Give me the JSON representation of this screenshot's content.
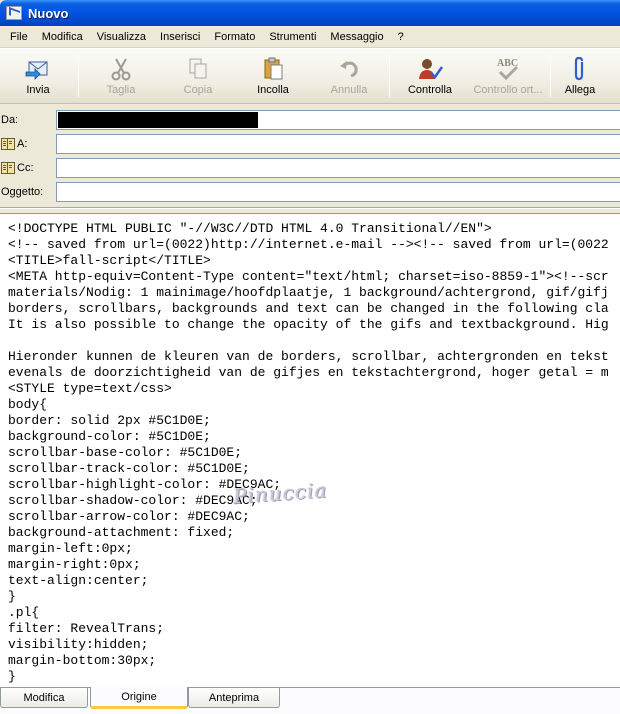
{
  "window": {
    "title": "Nuovo"
  },
  "menu": [
    "File",
    "Modifica",
    "Visualizza",
    "Inserisci",
    "Formato",
    "Strumenti",
    "Messaggio",
    "?"
  ],
  "toolbar": {
    "send": "Invia",
    "cut": "Taglia",
    "copy": "Copia",
    "paste": "Incolla",
    "undo": "Annulla",
    "check": "Controlla",
    "spelling": "Controllo ort...",
    "attach": "Allega"
  },
  "fields": {
    "from_label": "Da:",
    "to_label": "A:",
    "cc_label": "Cc:",
    "subject_label": "Oggetto:",
    "to_value": "",
    "cc_value": "",
    "subject_value": ""
  },
  "editor": {
    "lines": [
      "<!DOCTYPE HTML PUBLIC \"-//W3C//DTD HTML 4.0 Transitional//EN\">",
      "<!-- saved from url=(0022)http://internet.e-mail --><!-- saved from url=(0022",
      "<TITLE>fall-script</TITLE>",
      "<META http-equiv=Content-Type content=\"text/html; charset=iso-8859-1\"><!--scr",
      "materials/Nodig: 1 mainimage/hoofdplaatje, 1 background/achtergrond, gif/gifj",
      "borders, scrollbars, backgrounds and text can be changed in the following cla",
      "It is also possible to change the opacity of the gifs and textbackground. Hig",
      "",
      "Hieronder kunnen de kleuren van de borders, scrollbar, achtergronden en tekst",
      "evenals de doorzichtigheid van de gifjes en tekstachtergrond, hoger getal = m",
      "<STYLE type=text/css>",
      "body{",
      "border: solid 2px #5C1D0E;",
      "background-color: #5C1D0E;",
      "scrollbar-base-color: #5C1D0E;",
      "scrollbar-track-color: #5C1D0E;",
      "scrollbar-highlight-color: #DEC9AC;",
      "scrollbar-shadow-color: #DEC9AC;",
      "scrollbar-arrow-color: #DEC9AC;",
      "background-attachment: fixed;",
      "margin-left:0px;",
      "margin-right:0px;",
      "text-align:center;",
      "}",
      ".pl{",
      "filter: RevealTrans;",
      "visibility:hidden;",
      "margin-bottom:30px;",
      "}"
    ],
    "watermark": "Pinuccia"
  },
  "tabs": [
    "Modifica",
    "Origine",
    "Anteprima"
  ],
  "active_tab": "Origine",
  "colors": {
    "title_bar": "#0054e3",
    "active_tab_accent": "#ffc83c",
    "chrome": "#ece9d8"
  }
}
